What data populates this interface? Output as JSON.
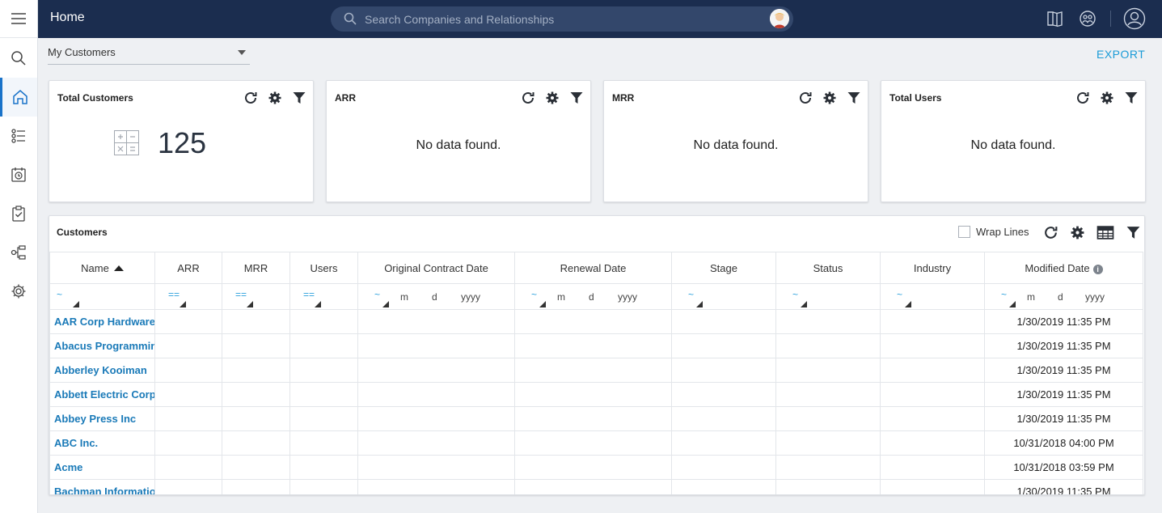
{
  "topbar": {
    "title": "Home",
    "search_placeholder": "Search Companies and Relationships"
  },
  "view_select": {
    "value": "My Customers"
  },
  "export_label": "EXPORT",
  "cards": [
    {
      "title": "Total Customers",
      "value": "125"
    },
    {
      "title": "ARR",
      "message": "No data found."
    },
    {
      "title": "MRR",
      "message": "No data found."
    },
    {
      "title": "Total Users",
      "message": "No data found."
    }
  ],
  "customers": {
    "title": "Customers",
    "wrap_lines_label": "Wrap Lines",
    "columns": [
      "Name",
      "ARR",
      "MRR",
      "Users",
      "Original Contract Date",
      "Renewal Date",
      "Stage",
      "Status",
      "Industry",
      "Modified Date"
    ],
    "filter": {
      "approx": "~",
      "eq": "==",
      "m": "m",
      "d": "d",
      "yyyy": "yyyy"
    },
    "rows": [
      {
        "name": "AAR Corp Hardware",
        "modified": "1/30/2019 11:35 PM"
      },
      {
        "name": "Abacus Programming",
        "modified": "1/30/2019 11:35 PM"
      },
      {
        "name": "Abberley Kooiman",
        "modified": "1/30/2019 11:35 PM"
      },
      {
        "name": "Abbett Electric Corp",
        "modified": "1/30/2019 11:35 PM"
      },
      {
        "name": "Abbey Press Inc",
        "modified": "1/30/2019 11:35 PM"
      },
      {
        "name": "ABC Inc.",
        "modified": "10/31/2018 04:00 PM"
      },
      {
        "name": "Acme",
        "modified": "10/31/2018 03:59 PM"
      },
      {
        "name": "Bachman Information",
        "modified": "1/30/2019 11:35 PM"
      }
    ]
  },
  "colors": {
    "topbar": "#1b2d4f",
    "accent": "#1a9bd7",
    "link": "#1a7ab8"
  }
}
